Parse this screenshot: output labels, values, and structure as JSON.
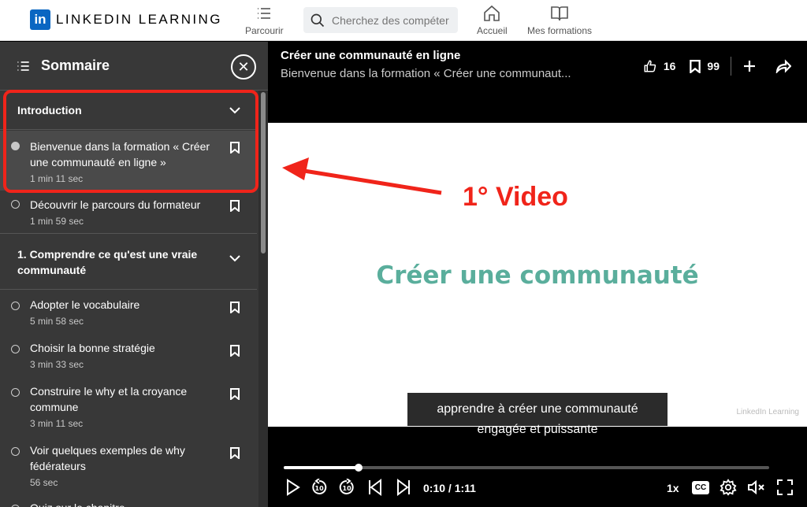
{
  "nav": {
    "logo_mark": "in",
    "logo_text": "LINKEDIN LEARNING",
    "parcours": "Parcourir",
    "search_placeholder": "Cherchez des compéter",
    "accueil": "Accueil",
    "formations": "Mes formations"
  },
  "sidebar": {
    "title": "Sommaire",
    "close": "✕",
    "sections": [
      {
        "title": "Introduction"
      },
      {
        "title": "1. Comprendre ce qu'est une vraie communauté"
      }
    ],
    "items": [
      {
        "label": "Bienvenue dans la formation « Créer une communauté en ligne »",
        "duration": "1 min 11 sec"
      },
      {
        "label": "Découvrir le parcours du formateur",
        "duration": "1 min 59 sec"
      },
      {
        "label": "Adopter le vocabulaire",
        "duration": "5 min 58 sec"
      },
      {
        "label": "Choisir la bonne stratégie",
        "duration": "3 min 33 sec"
      },
      {
        "label": "Construire le why et la croyance commune",
        "duration": "3 min 11 sec"
      },
      {
        "label": "Voir quelques exemples de why fédérateurs",
        "duration": "56 sec"
      },
      {
        "label": "Quiz sur le chapitre"
      }
    ]
  },
  "player": {
    "title": "Créer une communauté en ligne",
    "subtitle": "Bienvenue dans la formation « Créer une communaut...",
    "likes": "16",
    "saves": "99",
    "video_title": "Créer une communauté",
    "watermark": "LinkedIn Learning",
    "caption_line1": "apprendre à créer une communauté",
    "caption_line2": "engagée et puissante",
    "time": "0:10 / 1:11",
    "progress": 0.155,
    "speed": "1x",
    "cc": "CC"
  },
  "annotation": {
    "text": "1° Video",
    "color": "#f0241a"
  }
}
